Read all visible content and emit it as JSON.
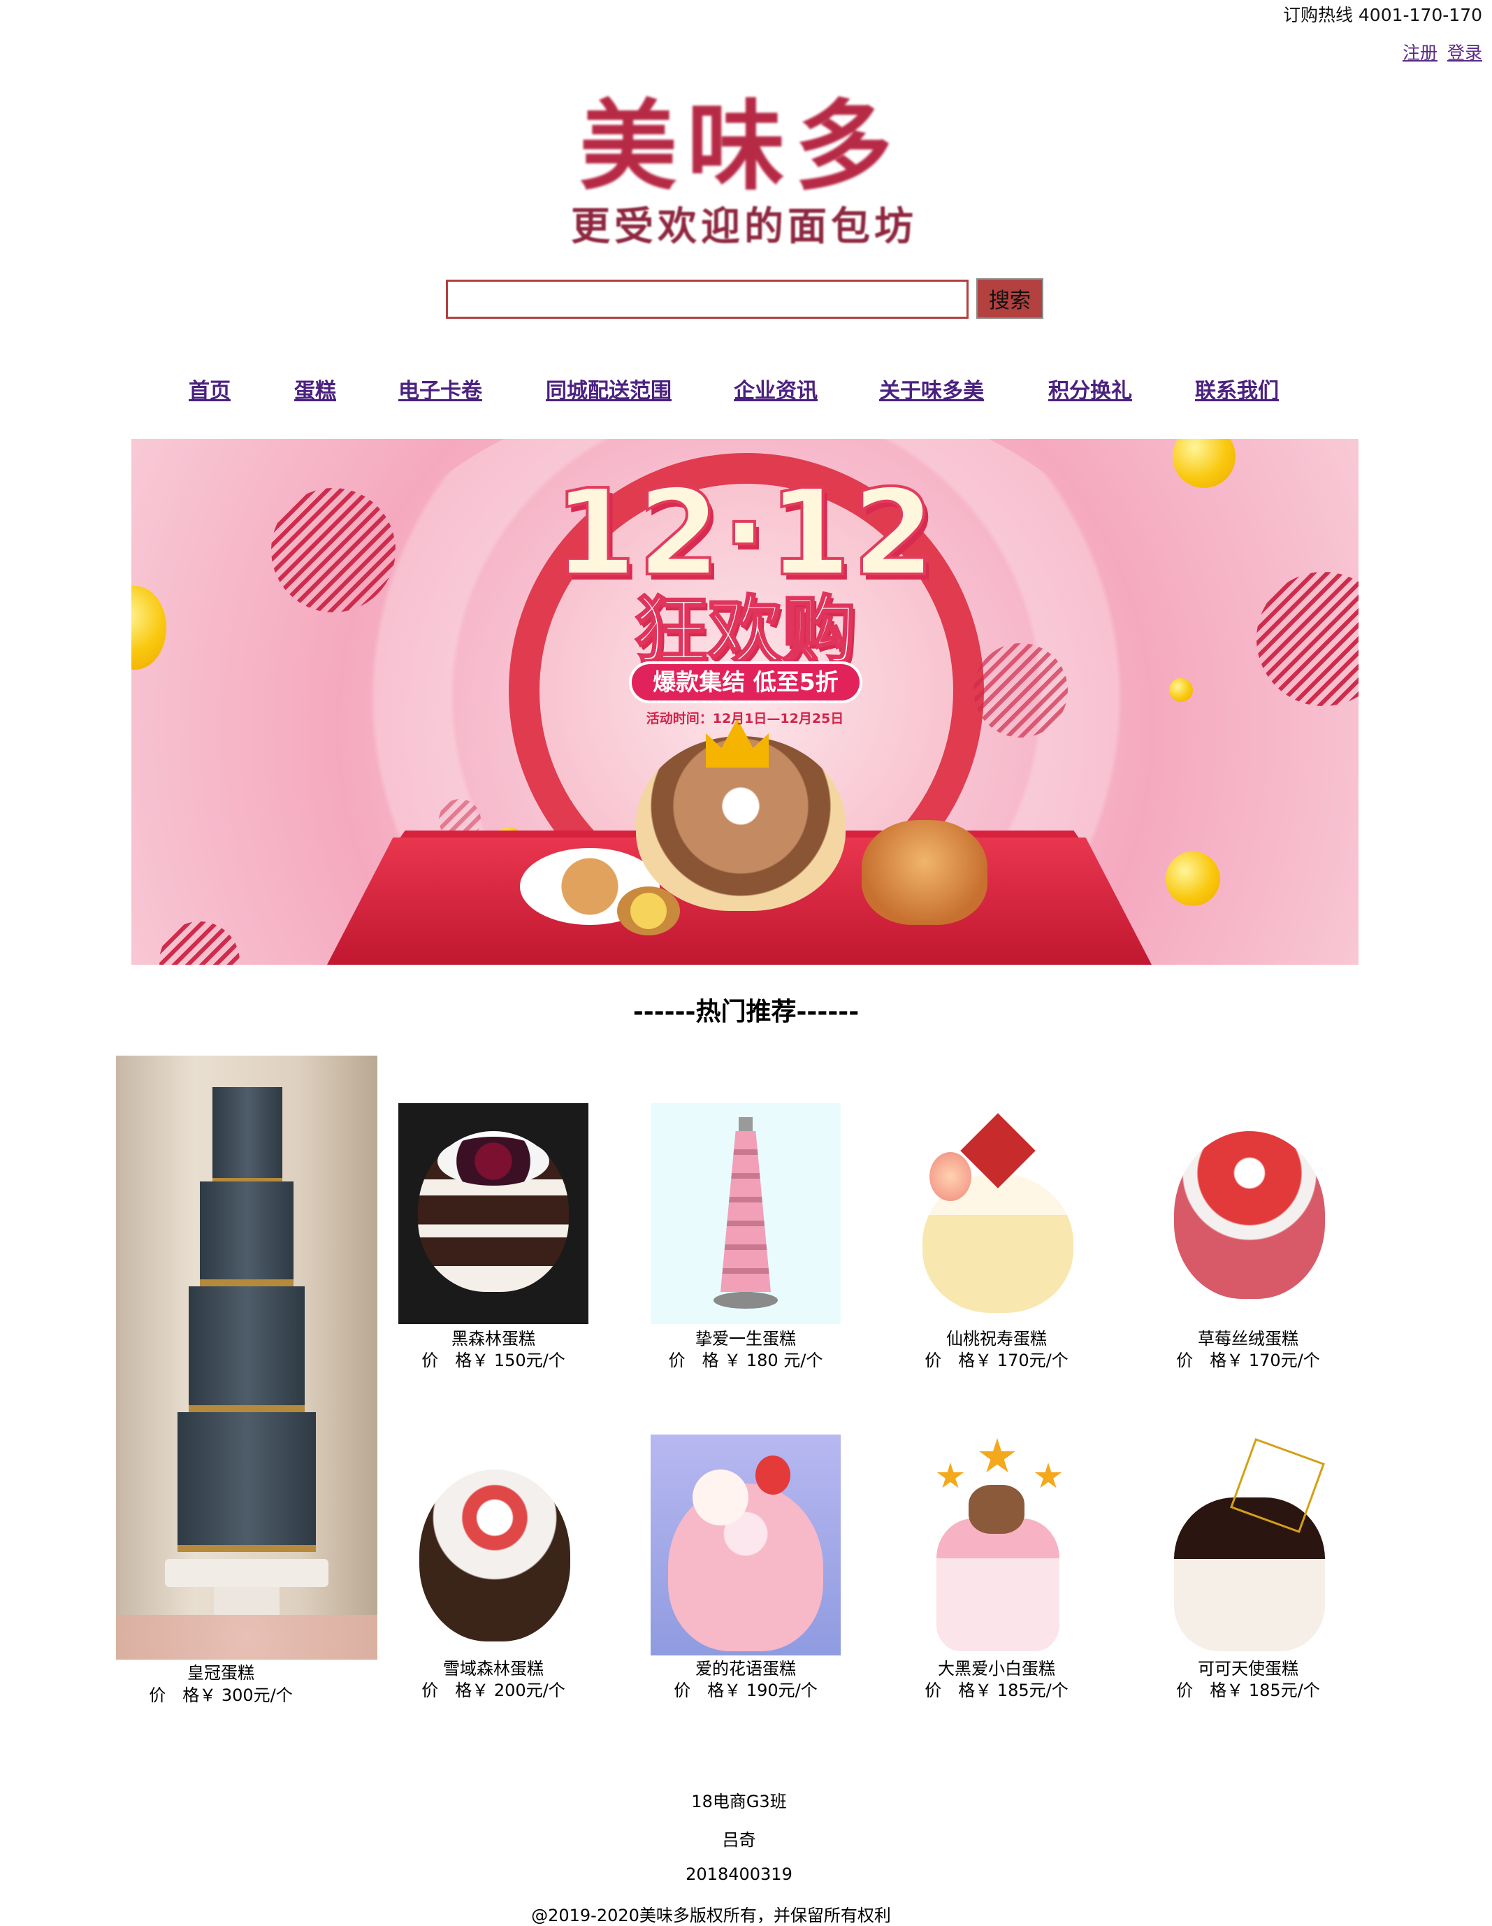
{
  "header": {
    "hotline": "订购热线 4001-170-170",
    "register": "注册",
    "login": "登录"
  },
  "logo": {
    "main": "美味多",
    "sub": "更受欢迎的面包坊"
  },
  "search": {
    "value": "",
    "placeholder": "",
    "button": "搜索"
  },
  "nav": [
    "首页",
    "蛋糕",
    "电子卡卷",
    "同城配送范围",
    "企业资讯",
    "关于味多美",
    "积分换礼",
    "联系我们"
  ],
  "banner": {
    "title": "12·12",
    "subtitle": "狂欢购",
    "pill": "爆款集结 低至5折",
    "date": "活动时间：12月1日—12月25日"
  },
  "section_title": "------热门推荐------",
  "featured": {
    "name": "皇冠蛋糕",
    "price": "价　格￥ 300元/个"
  },
  "products": [
    {
      "name": "黑森林蛋糕",
      "price": "价　格￥ 150元/个"
    },
    {
      "name": "挚爱一生蛋糕",
      "price": "价　格 ￥ 180 元/个"
    },
    {
      "name": "仙桃祝寿蛋糕",
      "price": "价　格￥ 170元/个"
    },
    {
      "name": "草莓丝绒蛋糕",
      "price": "价　格￥ 170元/个"
    },
    {
      "name": "雪域森林蛋糕",
      "price": "价　格￥ 200元/个"
    },
    {
      "name": "爱的花语蛋糕",
      "price": "价　格￥ 190元/个"
    },
    {
      "name": "大黑爱小白蛋糕",
      "price": "价　格￥ 185元/个"
    },
    {
      "name": "可可天使蛋糕",
      "price": "价　格￥ 185元/个"
    }
  ],
  "footer": {
    "class": "18电商G3班",
    "name": "吕奇",
    "id": "2018400319",
    "copyright": "@2019-2020美味多版权所有，并保留所有权利"
  },
  "colors": {
    "accent": "#b3413f",
    "link": "#4b2180",
    "banner_pink": "#f5a9bf",
    "banner_red": "#e2235b"
  }
}
